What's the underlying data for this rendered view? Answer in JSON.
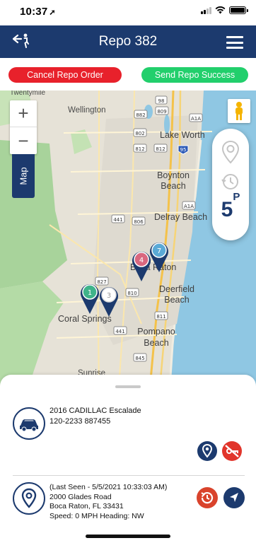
{
  "status_bar": {
    "time": "10:37",
    "icons": [
      "location-arrow-icon",
      "cellular-signal-icon",
      "wifi-icon",
      "battery-icon"
    ]
  },
  "navbar": {
    "title": "Repo 382",
    "back_icon": "agent-back-icon",
    "menu_icon": "hamburger-menu-icon",
    "background": "#1c3a6e"
  },
  "actions": {
    "cancel_label": "Cancel Repo Order",
    "cancel_color": "#e8212b",
    "success_label": "Send Repo Success",
    "success_color": "#22cf6c"
  },
  "map": {
    "zoom_in": "+",
    "zoom_out": "−",
    "map_tab": "Map",
    "places": [
      "Twentymile",
      "Wellington",
      "Lake Worth",
      "Boynton Beach",
      "Delray Beach",
      "Boca Raton",
      "Deerfield Beach",
      "Coral Springs",
      "Pompano Beach",
      "Sunrise"
    ],
    "road_shields": [
      "98",
      "809",
      "A1A",
      "882",
      "802",
      "812",
      "95",
      "A1A",
      "441",
      "806",
      "827",
      "810",
      "811",
      "441",
      "845"
    ],
    "markers": [
      {
        "number": "1",
        "color": "#3fb38a"
      },
      {
        "number": "3",
        "color": "#ffffff"
      },
      {
        "number": "4",
        "color": "#d9677f"
      },
      {
        "number": "7",
        "color": "#5aa9d6"
      }
    ],
    "side_panel": {
      "pin_icon": "map-pin-outline-icon",
      "clock_icon": "history-clock-icon",
      "count": "5",
      "count_suffix": "P"
    }
  },
  "vehicle": {
    "line1": "2016 CADILLAC Escalade",
    "line2": "120-2233 887455",
    "icon": "car-icon",
    "actions": [
      "location-pin-icon",
      "no-key-icon"
    ]
  },
  "location": {
    "line1": "(Last Seen - 5/5/2021 10:33:03 AM)",
    "line2": "2000 Glades Road",
    "line3": "Boca Raton, FL 33431",
    "line4": "Speed: 0 MPH  Heading: NW",
    "icon": "location-pin-icon",
    "actions": [
      "history-icon",
      "navigate-arrow-icon"
    ]
  }
}
